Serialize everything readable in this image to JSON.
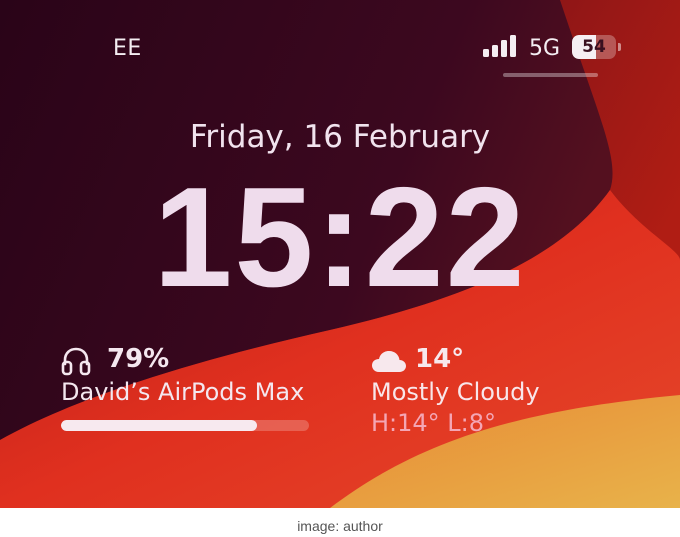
{
  "status_bar": {
    "carrier": "EE",
    "network": "5G",
    "battery_level": "54",
    "battery_fraction": 0.54
  },
  "lock_screen": {
    "date": "Friday, 16 February",
    "time": "15:22"
  },
  "widgets": {
    "airpods": {
      "icon": "headphones-icon",
      "percent": "79%",
      "level": 0.79,
      "name": "David’s AirPods Max"
    },
    "weather": {
      "icon": "cloud-icon",
      "temperature": "14°",
      "condition": "Mostly Cloudy",
      "high_low": "H:14° L:8°"
    }
  },
  "caption": "image: author",
  "colors": {
    "wallpaper_dark": "#2a0a18",
    "wallpaper_red": "#d9261c",
    "wallpaper_orange": "#e8a23a",
    "text_pink": "#efdcec"
  }
}
